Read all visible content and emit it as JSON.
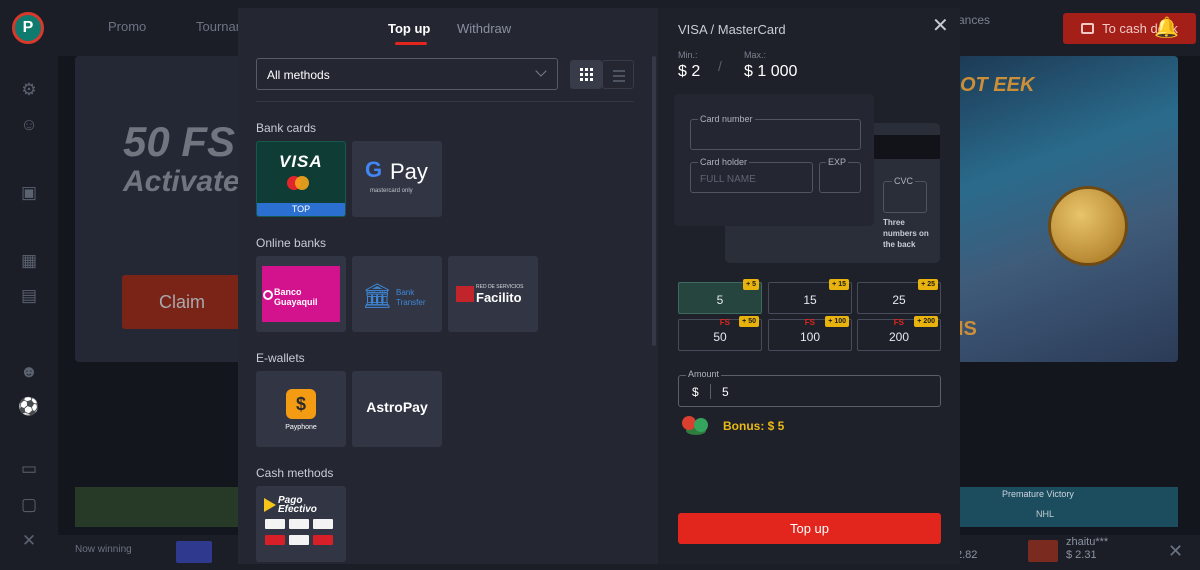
{
  "site": {
    "logo": "P",
    "nav": [
      "Promo",
      "Tourname"
    ],
    "balance_label": "ances",
    "cash_desk": "To cash desk",
    "hero": {
      "title": "50 FS",
      "subtitle": "Activate play wit",
      "claim": "Claim"
    },
    "promo_word": "OT EEK",
    "promo_tm": "IS",
    "strip_tag": "Premature Victory",
    "strip_league": "NHL",
    "ticker": {
      "now_winning": "Now winning",
      "item1_user": "zhaitu***",
      "item1_amount": "$ 2.31",
      "item2_amount": "2.82"
    }
  },
  "modal": {
    "tabs": [
      {
        "label": "Top up",
        "active": true
      },
      {
        "label": "Withdraw",
        "active": false
      }
    ],
    "filter": {
      "value": "All methods"
    },
    "sections": [
      {
        "title": "Bank cards"
      },
      {
        "title": "Online banks"
      },
      {
        "title": "E-wallets"
      },
      {
        "title": "Cash methods"
      }
    ],
    "methods": {
      "visa": {
        "logo": "VISA",
        "badge": "TOP"
      },
      "gpay": {
        "g": "G",
        "pay": "Pay",
        "sub": "mastercard only"
      },
      "banco": {
        "text": "Banco Guayaquil"
      },
      "bank_transfer": {
        "text": "Bank Transfer"
      },
      "facilito": {
        "small": "RED DE SERVICIOS",
        "text": "Facilito"
      },
      "payphone": {
        "text": "Payphone"
      },
      "astropay": {
        "text": "AstroPay"
      },
      "pagoefectivo": {
        "text": "Pago Efectivo"
      }
    },
    "form": {
      "title": "VISA / MasterCard",
      "min_label": "Min.:",
      "min_value": "$ 2",
      "max_label": "Max.:",
      "max_value": "$ 1 000",
      "card_number_label": "Card number",
      "card_holder_label": "Card holder",
      "card_holder_placeholder": "FULL NAME",
      "exp_label": "EXP",
      "cvc_label": "CVC",
      "cvc_hint": "Three numbers on the back",
      "amount_options": [
        {
          "value": "5",
          "badge": "+ 5",
          "fs": false,
          "selected": true
        },
        {
          "value": "15",
          "badge": "+ 15",
          "fs": false,
          "selected": false
        },
        {
          "value": "25",
          "badge": "+ 25",
          "fs": false,
          "selected": false
        },
        {
          "value": "50",
          "badge": "+ 50",
          "fs": true,
          "selected": false
        },
        {
          "value": "100",
          "badge": "+ 100",
          "fs": true,
          "selected": false
        },
        {
          "value": "200",
          "badge": "+ 200",
          "fs": true,
          "selected": false
        }
      ],
      "fs_mark": "FS",
      "amount_label": "Amount",
      "currency": "$",
      "amount_value": "5",
      "bonus": "Bonus: $ 5",
      "submit": "Top up"
    }
  },
  "colors": {
    "accent": "#e2261d",
    "bonus": "#e8b917",
    "selected_chip": "#26453f"
  }
}
